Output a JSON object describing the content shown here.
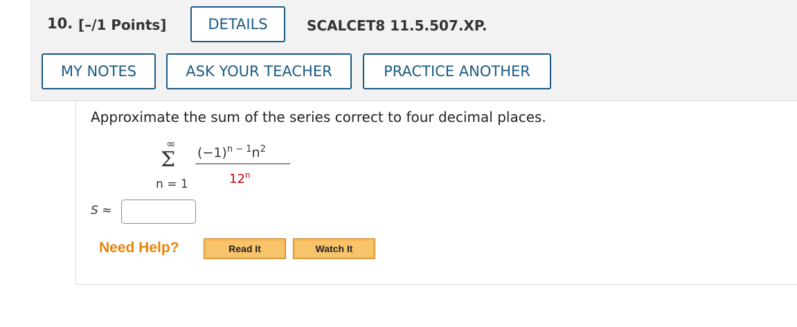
{
  "question": {
    "number": "10.",
    "points": "[–/1 Points]",
    "details_label": "DETAILS",
    "code": "SCALCET8 11.5.507.XP."
  },
  "actions": {
    "my_notes": "MY NOTES",
    "ask_teacher": "ASK YOUR TEACHER",
    "practice_another": "PRACTICE ANOTHER"
  },
  "problem": {
    "prompt": "Approximate the sum of the series correct to four decimal places.",
    "series": {
      "upper_limit": "∞",
      "lower_limit": "n = 1",
      "numerator_base": "(−1)",
      "numerator_exp": "n − 1",
      "numerator_tail": "n",
      "numerator_tail_exp": "2",
      "denominator_base": "12",
      "denominator_exp": "n"
    },
    "answer_label": "S",
    "answer_symbol": "≈",
    "answer_value": ""
  },
  "help": {
    "label": "Need Help?",
    "read_it": "Read It",
    "watch_it": "Watch It"
  },
  "colors": {
    "button_border": "#1a5a82",
    "help_text": "#e8830a",
    "denominator": "#cc0000"
  }
}
